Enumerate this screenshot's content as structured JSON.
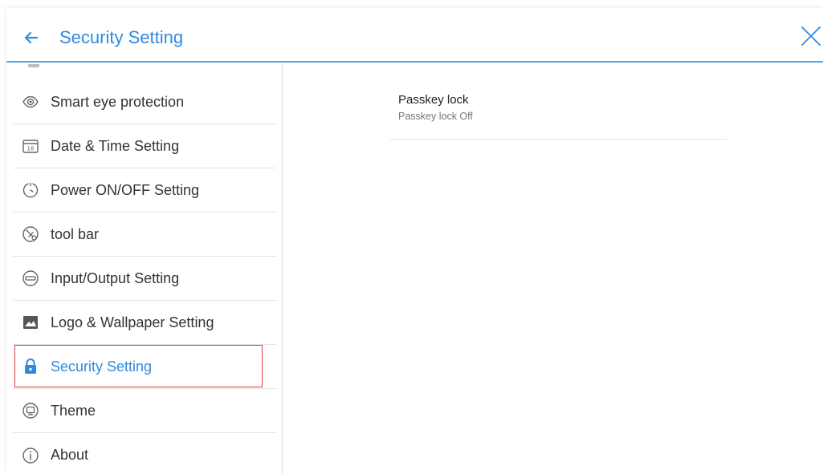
{
  "header": {
    "title": "Security Setting",
    "back_icon": "arrow-left-icon",
    "close_icon": "close-icon",
    "accent_color": "#2f8ae0"
  },
  "sidebar": {
    "items": [
      {
        "label": "Smart eye protection",
        "icon": "eye-icon"
      },
      {
        "label": "Date & Time Setting",
        "icon": "calendar-icon"
      },
      {
        "label": "Power ON/OFF Setting",
        "icon": "timer-icon"
      },
      {
        "label": "tool bar",
        "icon": "toolbar-icon"
      },
      {
        "label": "Input/Output Setting",
        "icon": "input-output-icon"
      },
      {
        "label": "Logo & Wallpaper Setting",
        "icon": "image-icon"
      },
      {
        "label": "Security Setting",
        "icon": "lock-icon",
        "selected": true
      },
      {
        "label": "Theme",
        "icon": "theme-icon"
      },
      {
        "label": "About",
        "icon": "info-icon"
      }
    ]
  },
  "content": {
    "passkey": {
      "title": "Passkey lock",
      "summary": "Passkey lock Off"
    }
  }
}
